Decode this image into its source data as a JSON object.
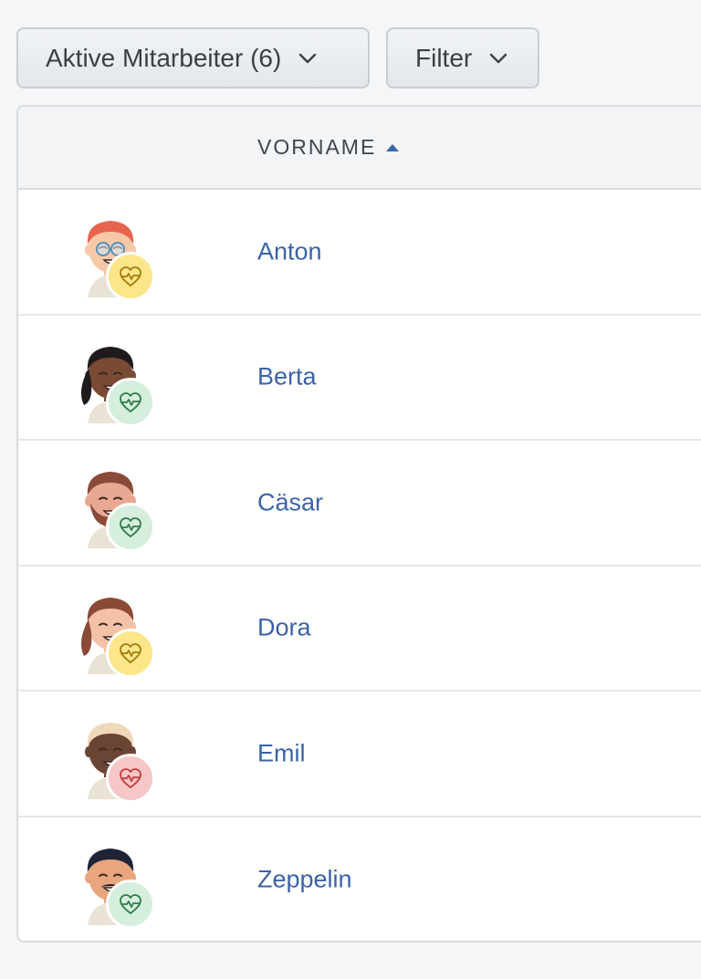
{
  "toolbar": {
    "employees_filter_label": "Aktive Mitarbeiter (6)",
    "filter_label": "Filter"
  },
  "table": {
    "column_firstname": "VORNAME",
    "sort": "ascending",
    "rows": [
      {
        "name": "Anton",
        "status": "yellow",
        "hair": "#e7654d",
        "skin": "#f6c8a8",
        "glasses": true
      },
      {
        "name": "Berta",
        "status": "green",
        "hair": "#1f1a1d",
        "skin": "#7a4a34"
      },
      {
        "name": "Cäsar",
        "status": "green",
        "hair": "#8a4a3a",
        "skin": "#e8a891",
        "beard": true
      },
      {
        "name": "Dora",
        "status": "yellow",
        "hair": "#8a4a35",
        "skin": "#f3c1a5"
      },
      {
        "name": "Emil",
        "status": "red",
        "hair": "#efd9b9",
        "skin": "#6b4534"
      },
      {
        "name": "Zeppelin",
        "status": "green",
        "hair": "#1e2436",
        "skin": "#e9a57d",
        "mustache": true
      }
    ]
  },
  "colors": {
    "status_yellow_bg": "#fbe68a",
    "status_yellow_fg": "#a57b0a",
    "status_green_bg": "#d6eedd",
    "status_green_fg": "#2f7b45",
    "status_red_bg": "#f6c7c7",
    "status_red_fg": "#c53a3a",
    "link": "#3b63a6"
  }
}
